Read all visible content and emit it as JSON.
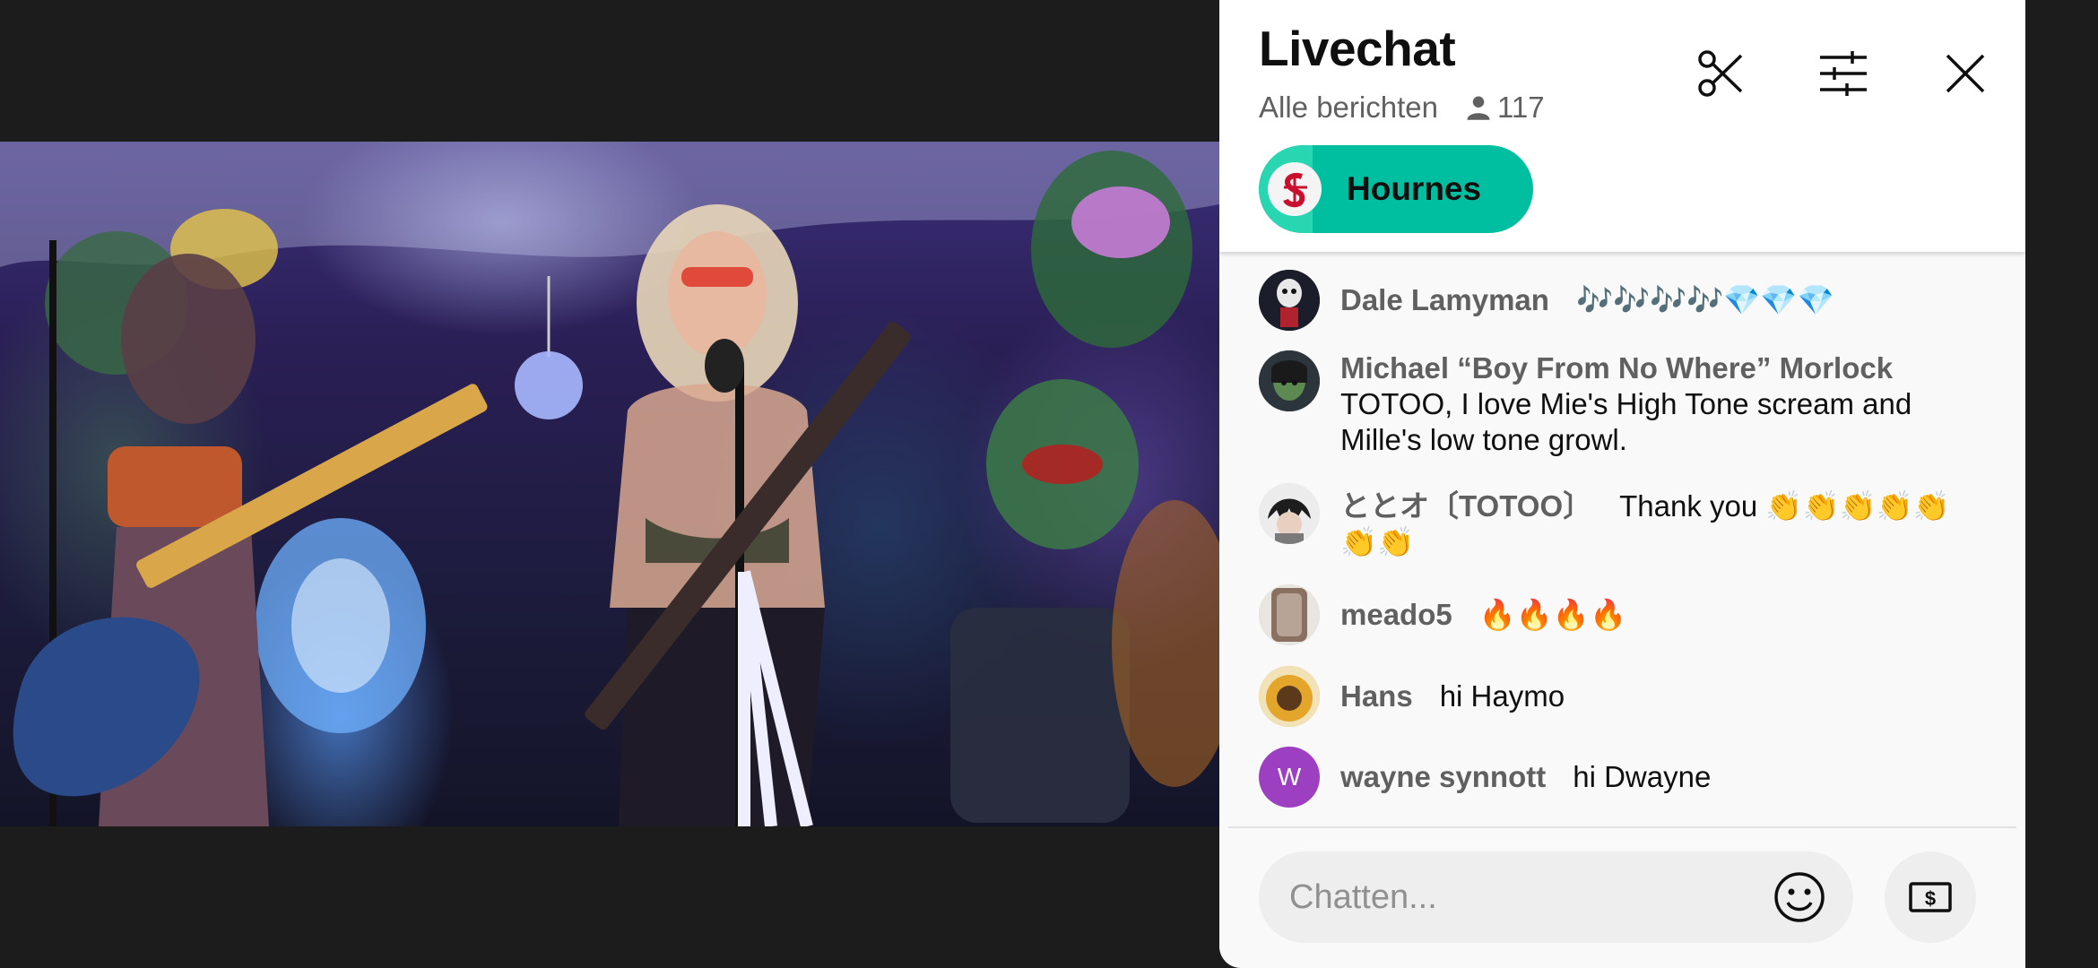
{
  "video": {
    "description_visible": ""
  },
  "chat": {
    "title": "Livechat",
    "filter_label": "Alle berichten",
    "viewer_count": "117",
    "pinned": {
      "name": "Hournes"
    },
    "input_placeholder": "Chatten...",
    "messages": [
      {
        "author": "Dale Lamyman",
        "text": "🎶🎶🎶🎶💎💎💎",
        "avatar_icon": "skull-portrait-avatar"
      },
      {
        "author": "Michael “Boy From No Where” Morlock",
        "text": "TOTOO, I love Mie's High Tone scream and Mille's low tone growl.",
        "avatar_icon": "green-face-avatar"
      },
      {
        "author": "ととオ〔TOTOO〕",
        "text": "Thank you 👏👏👏👏👏👏👏",
        "avatar_icon": "anime-avatar"
      },
      {
        "author": "meado5",
        "text": "🔥🔥🔥🔥",
        "avatar_icon": "photo-avatar"
      },
      {
        "author": "Hans",
        "text": "hi Haymo",
        "avatar_icon": "sunflower-avatar"
      },
      {
        "author": "wayne synnott",
        "text": "hi Dwayne",
        "avatar_letter": "W",
        "avatar_color": "#9c3fc0"
      }
    ]
  },
  "colors": {
    "accent_chip": "#00bfa0",
    "panel_bg": "#f9f9f9",
    "page_bg": "#1c1c1c"
  }
}
